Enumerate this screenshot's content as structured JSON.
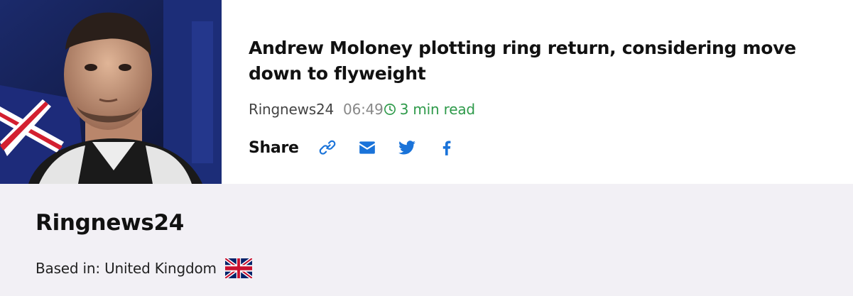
{
  "article": {
    "headline": "Andrew Moloney plotting ring return, considering move down to flyweight",
    "source": "Ringnews24",
    "time": "06:49",
    "read_time": "3 min read",
    "share_label": "Share",
    "share_buttons": [
      {
        "icon": "link-icon"
      },
      {
        "icon": "mail-icon"
      },
      {
        "icon": "twitter-icon"
      },
      {
        "icon": "facebook-icon"
      }
    ],
    "image_alt": "Andrew Moloney"
  },
  "source_info": {
    "name": "Ringnews24",
    "based_in": "Based in: United Kingdom",
    "flag_icon": "uk-flag-icon"
  },
  "colors": {
    "accent": "#1a73d9",
    "read_time": "#2e9a4a",
    "footer_bg": "#f2f0f5"
  }
}
